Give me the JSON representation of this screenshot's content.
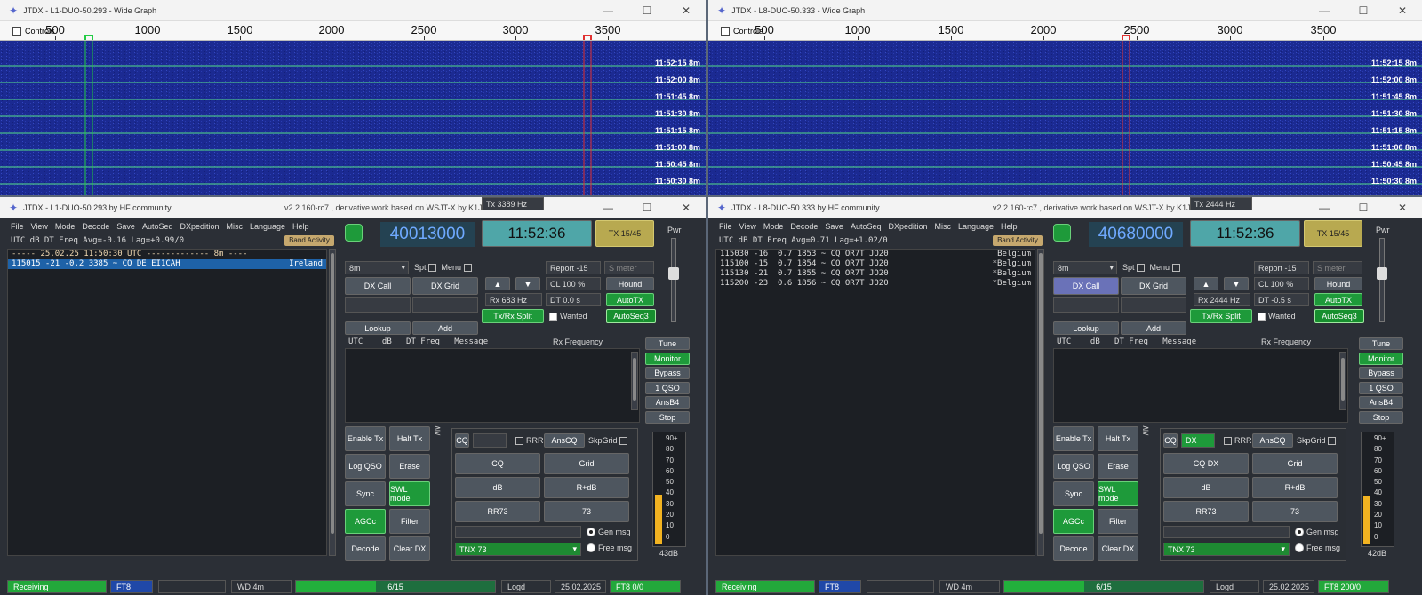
{
  "panes": [
    {
      "wide_graph_title": "JTDX - L1-DUO-50.293 - Wide Graph",
      "controls_label": "Controls",
      "ticks": [
        "500",
        "1000",
        "1500",
        "2000",
        "2500",
        "3000",
        "3500"
      ],
      "timestamps": [
        "11:52:15",
        "11:52:00",
        "11:51:45",
        "11:51:30",
        "11:51:15",
        "11:51:00",
        "11:50:45",
        "11:50:30"
      ],
      "band_tag": "8m",
      "main_title": "JTDX - L1-DUO-50.293  by HF community",
      "version": "v2.2.160-rc7 , derivative work based on WSJT-X by K1JT",
      "menu": [
        "File",
        "View",
        "Mode",
        "Decode",
        "Save",
        "AutoSeq",
        "DXpedition",
        "Misc",
        "Language",
        "Help"
      ],
      "band_header": "UTC    dB   DT Freq    Avg=-0.16 Lag=+0.99/0",
      "band_activity_btn": "Band Activity",
      "decodes": [
        {
          "text": "----- 25.02.25 11:50:30 UTC ------------- 8m ----",
          "country": "",
          "type": "sep"
        },
        {
          "text": "115015 -21 -0.2 3385 ~ CQ DE EI1CAH",
          "country": "Ireland",
          "type": "sel"
        }
      ],
      "dial_freq": "40013000",
      "clock": "11:52:36",
      "tx_period": "TX 15/45",
      "band_select": "8m",
      "spt": "Spt",
      "menu_chk": "Menu",
      "tx_hz": "Tx  3389  Hz",
      "report": "Report -15",
      "smeter": "S meter",
      "dx_call_btn": "DX Call",
      "dx_grid_btn": "DX Grid",
      "cl": "CL  100 %",
      "hound": "Hound",
      "rx_hz": "Rx  683  Hz",
      "dt": "DT  0.0 s",
      "autotx": "AutoTX",
      "txrx_split": "Tx/Rx Split",
      "wanted": "Wanted",
      "autoseq3": "AutoSeq3",
      "lookup": "Lookup",
      "add": "Add",
      "pwr": "Pwr",
      "rx_header": "UTC    dB   DT Freq   Message",
      "rx_freq_label": "Rx Frequency",
      "side_btns": [
        "Tune",
        "Monitor",
        "Bypass",
        "1 QSO",
        "AnsB4",
        "Stop"
      ],
      "left_btns": [
        "Enable Tx",
        "Halt Tx",
        "Log QSO",
        "Erase",
        "Sync",
        "SWL mode",
        "AGCc",
        "Filter",
        "Decode",
        "Clear DX"
      ],
      "cq_label": "CQ",
      "cq_field": "",
      "rrr": "RRR",
      "anscq": "AnsCQ",
      "skpgrid": "SkpGrid",
      "msg_btns": [
        "CQ",
        "Grid",
        "dB",
        "R+dB",
        "RR73",
        "73"
      ],
      "gen_msg": "Gen msg",
      "free_msg": "Free msg",
      "free_text": "TNX 73",
      "meter_labels": [
        "90+",
        "80",
        "70",
        "60",
        "50",
        "40",
        "30",
        "20",
        "10",
        "0"
      ],
      "meter_db": "43dB",
      "meter_level": 0.45,
      "status": {
        "receiving": "Receiving",
        "mode": "FT8",
        "wd": "WD 4m",
        "progress": "6/15",
        "progress_value": 0.4,
        "logd": "Logd",
        "date": "25.02.2025",
        "mode2": "FT8  0/0"
      }
    },
    {
      "wide_graph_title": "JTDX - L8-DUO-50.333 - Wide Graph",
      "controls_label": "Controls",
      "ticks": [
        "500",
        "1000",
        "1500",
        "2000",
        "2500",
        "3000",
        "3500"
      ],
      "timestamps": [
        "11:52:15",
        "11:52:00",
        "11:51:45",
        "11:51:30",
        "11:51:15",
        "11:51:00",
        "11:50:45",
        "11:50:30"
      ],
      "band_tag": "8m",
      "main_title": "JTDX - L8-DUO-50.333  by HF community",
      "version": "v2.2.160-rc7 , derivative work based on WSJT-X by K1JT",
      "menu": [
        "File",
        "View",
        "Mode",
        "Decode",
        "Save",
        "AutoSeq",
        "DXpedition",
        "Misc",
        "Language",
        "Help"
      ],
      "band_header": "UTC    dB   DT Freq    Avg=0.71 Lag=+1.02/0",
      "band_activity_btn": "Band Activity",
      "decodes": [
        {
          "text": "115030 -16  0.7 1853 ~ CQ OR7T JO20",
          "country": "Belgium",
          "type": "norm"
        },
        {
          "text": "115100 -15  0.7 1854 ~ CQ OR7T JO20",
          "country": "*Belgium",
          "type": "norm"
        },
        {
          "text": "115130 -21  0.7 1855 ~ CQ OR7T JO20",
          "country": "*Belgium",
          "type": "norm"
        },
        {
          "text": "115200 -23  0.6 1856 ~ CQ OR7T JO20",
          "country": "*Belgium",
          "type": "norm"
        }
      ],
      "dial_freq": "40680000",
      "clock": "11:52:36",
      "tx_period": "TX 15/45",
      "band_select": "8m",
      "spt": "Spt",
      "menu_chk": "Menu",
      "tx_hz": "Tx  2444  Hz",
      "report": "Report -15",
      "smeter": "S meter",
      "dx_call_btn": "DX Call",
      "dx_grid_btn": "DX Grid",
      "cl": "CL  100 %",
      "hound": "Hound",
      "rx_hz": "Rx  2444  Hz",
      "dt": "DT  -0.5 s",
      "autotx": "AutoTX",
      "txrx_split": "Tx/Rx Split",
      "wanted": "Wanted",
      "autoseq3": "AutoSeq3",
      "lookup": "Lookup",
      "add": "Add",
      "pwr": "Pwr",
      "rx_header": "UTC    dB   DT Freq   Message",
      "rx_freq_label": "Rx Frequency",
      "side_btns": [
        "Tune",
        "Monitor",
        "Bypass",
        "1 QSO",
        "AnsB4",
        "Stop"
      ],
      "left_btns": [
        "Enable Tx",
        "Halt Tx",
        "Log QSO",
        "Erase",
        "Sync",
        "SWL mode",
        "AGCc",
        "Filter",
        "Decode",
        "Clear DX"
      ],
      "cq_label": "CQ",
      "cq_field": "DX",
      "rrr": "RRR",
      "anscq": "AnsCQ",
      "skpgrid": "SkpGrid",
      "msg_btns": [
        "CQ DX",
        "Grid",
        "dB",
        "R+dB",
        "RR73",
        "73"
      ],
      "gen_msg": "Gen msg",
      "free_msg": "Free msg",
      "free_text": "TNX 73",
      "meter_labels": [
        "90+",
        "80",
        "70",
        "60",
        "50",
        "40",
        "30",
        "20",
        "10",
        "0"
      ],
      "meter_db": "42dB",
      "meter_level": 0.44,
      "status": {
        "receiving": "Receiving",
        "mode": "FT8",
        "wd": "WD 4m",
        "progress": "6/15",
        "progress_value": 0.4,
        "logd": "Logd",
        "date": "25.02.2025",
        "mode2": "FT8  200/0"
      }
    }
  ],
  "colors": {
    "waterfall": "#1a2a9a",
    "waterfall_line": "#55e08a",
    "rx_marker": "#22cc44",
    "tx_marker": "#e03030",
    "accent_green": "#1e9a3a",
    "selected_row": "#1e62a8"
  }
}
